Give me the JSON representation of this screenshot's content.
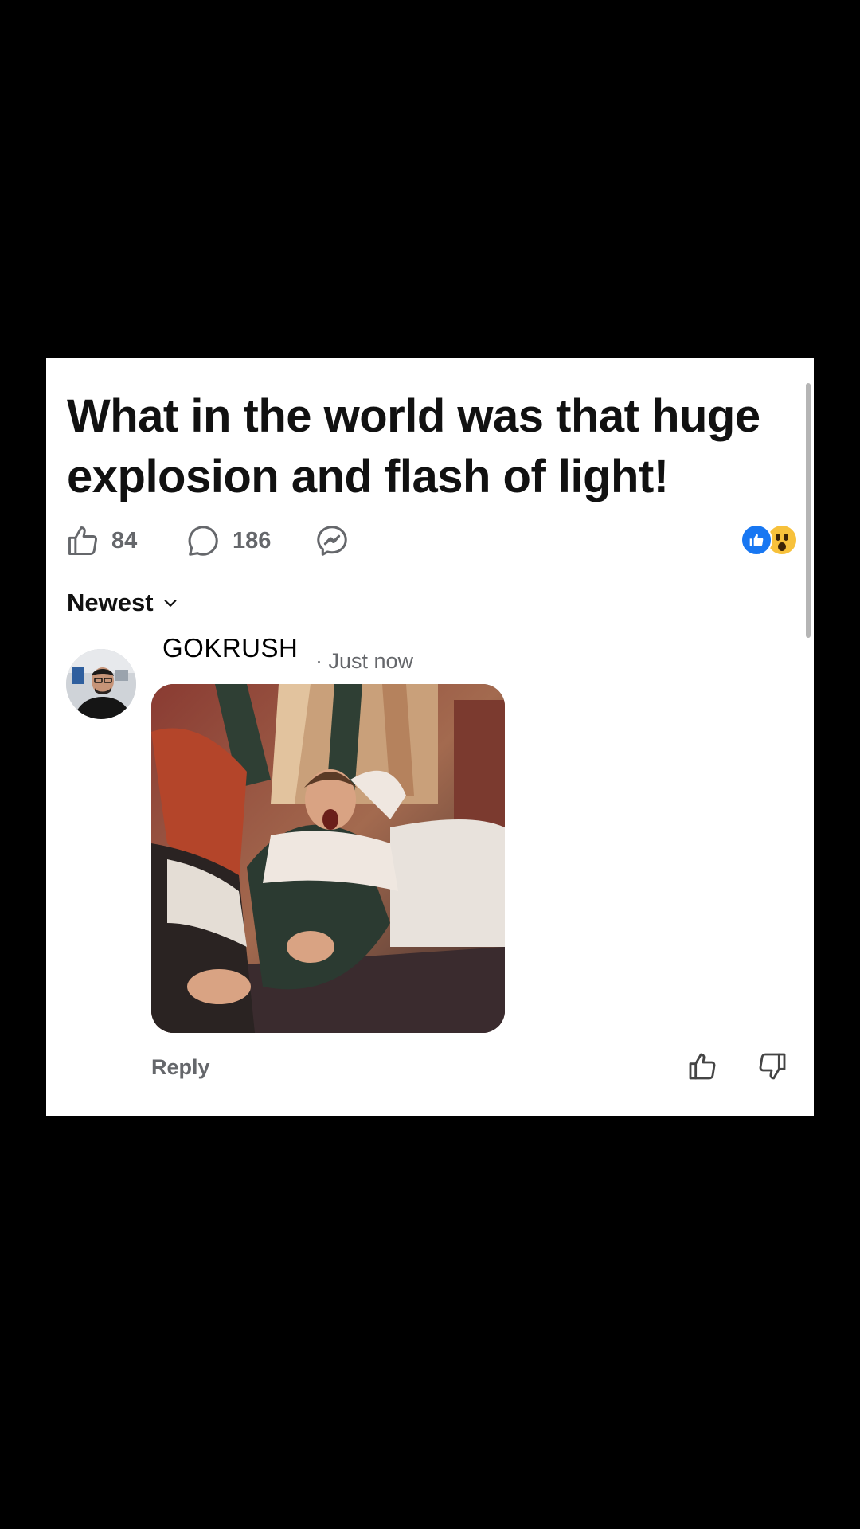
{
  "post": {
    "title": "What in the world was that huge explosion and flash of light!",
    "likes_count": "84",
    "comments_count": "186",
    "reactions": [
      "like-reaction-icon",
      "wow-reaction-icon"
    ]
  },
  "comments_section": {
    "sort_label": "Newest"
  },
  "comment": {
    "username": "GOKRUSH",
    "timestamp": "· Just now",
    "reply_label": "Reply"
  },
  "colors": {
    "background": "#000000",
    "card": "#ffffff",
    "text_primary": "#111111",
    "text_secondary": "#65676b",
    "like_blue": "#1877f2",
    "wow_yellow": "#f7c13b"
  }
}
